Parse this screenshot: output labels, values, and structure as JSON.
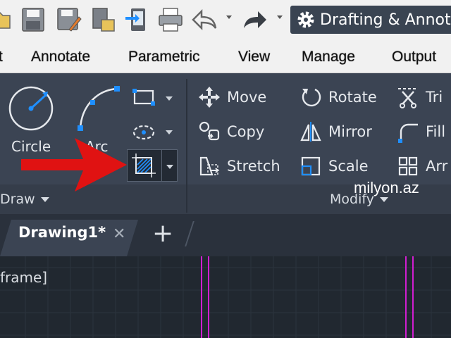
{
  "quick_access": {
    "icons": [
      "open-folder-icon",
      "save-icon",
      "save-as-icon",
      "publish-icon",
      "import-icon",
      "plot-icon",
      "undo-icon",
      "redo-icon"
    ],
    "workspace_label": "Drafting & Annot"
  },
  "ribbon_tabs": [
    "t",
    "Annotate",
    "Parametric",
    "View",
    "Manage",
    "Output"
  ],
  "draw_panel": {
    "circle_label": "Circle",
    "arc_label": "Arc",
    "footer_label": "Draw"
  },
  "modify_panel": {
    "tools": [
      {
        "label": "Move",
        "icon": "move-icon"
      },
      {
        "label": "Rotate",
        "icon": "rotate-icon"
      },
      {
        "label": "Tri",
        "icon": "trim-icon"
      },
      {
        "label": "Copy",
        "icon": "copy-icon"
      },
      {
        "label": "Mirror",
        "icon": "mirror-icon"
      },
      {
        "label": "Fill",
        "icon": "fillet-icon"
      },
      {
        "label": "Stretch",
        "icon": "stretch-icon"
      },
      {
        "label": "Scale",
        "icon": "scale-icon"
      },
      {
        "label": "Arr",
        "icon": "array-icon"
      }
    ],
    "footer_label": "Modify"
  },
  "watermark": "milyon.az",
  "document_tabs": {
    "active_label": "Drawing1*",
    "close_symbol": "✕",
    "new_symbol": "+"
  },
  "canvas": {
    "viewport_label": "frame]"
  },
  "colors": {
    "ribbon_bg": "#3b4453",
    "arrow": "#e01212",
    "magenta_lines": "#d11ed1",
    "accent_blue": "#1f8fff"
  }
}
